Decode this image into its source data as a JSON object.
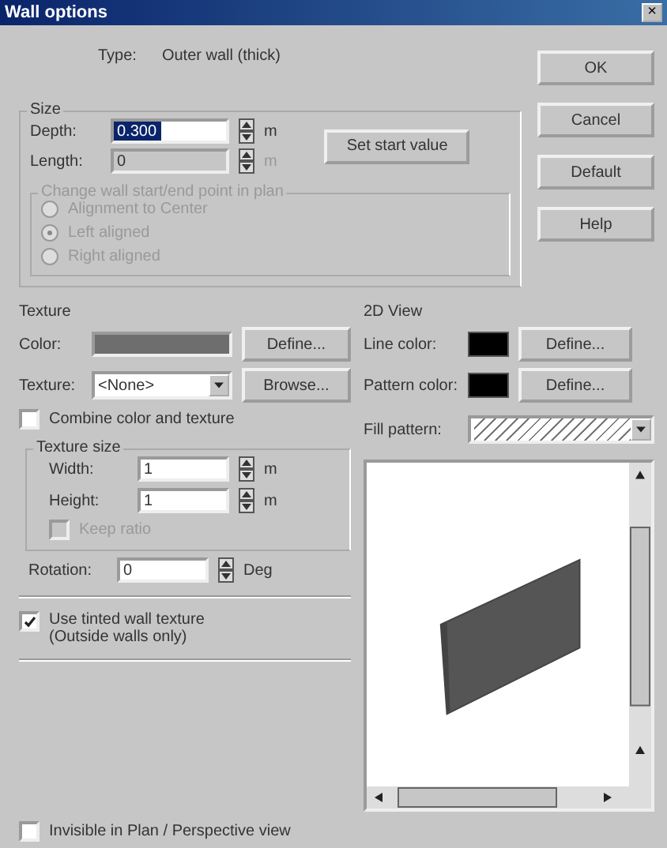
{
  "window": {
    "title": "Wall options",
    "close": "×"
  },
  "type": {
    "label": "Type:",
    "value": "Outer wall (thick)"
  },
  "size": {
    "label": "Size",
    "set_start_button": "Set start value",
    "fields": [
      {
        "label": "Depth:",
        "value": "0.300",
        "unit": "m",
        "highlighted": true,
        "disabled": false
      },
      {
        "label": "Length:",
        "value": "0",
        "unit": "m",
        "highlighted": false,
        "disabled": true
      }
    ]
  },
  "alignment": {
    "label": "Change wall start/end point in plan",
    "disabled": true,
    "options": [
      {
        "label": "Alignment to Center",
        "selected": false
      },
      {
        "label": "Left aligned",
        "selected": true
      },
      {
        "label": "Right aligned",
        "selected": false
      }
    ]
  },
  "buttons": [
    "OK",
    "Cancel",
    "Default",
    "Help"
  ],
  "texture": {
    "label": "Texture",
    "color_label": "Color:",
    "define_button": "Define...",
    "texture_label": "Texture:",
    "texture_value": "<None>",
    "browse_button": "Browse...",
    "combine": {
      "label": "Combine color and texture",
      "checked": false
    },
    "size_group": {
      "label": "Texture size",
      "fields": [
        {
          "label": "Width:",
          "value": "1",
          "unit": "m"
        },
        {
          "label": "Height:",
          "value": "1",
          "unit": "m"
        }
      ],
      "keep_ratio": {
        "label": "Keep ratio",
        "checked": false,
        "disabled": true
      }
    },
    "rotation": {
      "label": "Rotation:",
      "value": "0",
      "unit": "Deg"
    },
    "tinted": {
      "label": "Use tinted wall texture\n(Outside walls only)",
      "checked": true
    }
  },
  "view2d": {
    "label": "2D View",
    "rows": [
      {
        "label": "Line color:",
        "button": "Define..."
      },
      {
        "label": "Pattern color:",
        "button": "Define..."
      }
    ],
    "fill_label": "Fill pattern:"
  },
  "invisible": {
    "label": "Invisible in Plan / Perspective view",
    "checked": false
  }
}
